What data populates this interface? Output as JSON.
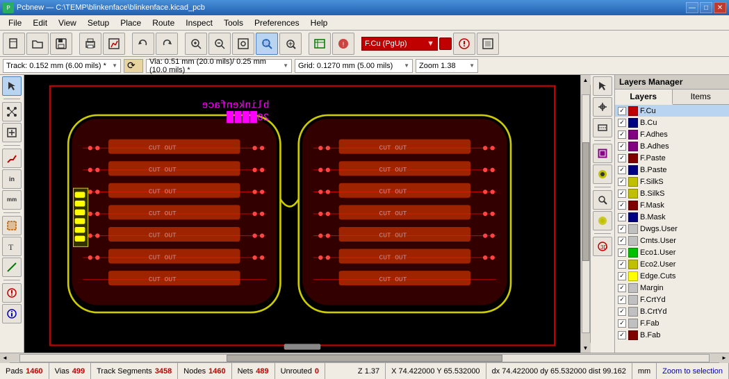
{
  "titlebar": {
    "title": "Pcbnew — C:\\TEMP\\blinkenface\\blinkenface.kicad_pcb",
    "app_icon": "P",
    "minimize": "—",
    "maximize": "□",
    "close": "✕"
  },
  "menu": {
    "items": [
      "File",
      "Edit",
      "View",
      "Setup",
      "Place",
      "Route",
      "Inspect",
      "Tools",
      "Preferences",
      "Help"
    ]
  },
  "toolbar1": {
    "buttons": [
      {
        "icon": "⊞",
        "name": "new-file"
      },
      {
        "icon": "📁",
        "name": "open-file"
      },
      {
        "icon": "💾",
        "name": "save-file"
      },
      {
        "icon": "⊟",
        "name": "save-gerber"
      },
      {
        "icon": "⊞",
        "name": "page-setup"
      },
      {
        "icon": "⊡",
        "name": "print"
      },
      {
        "icon": "📋",
        "name": "plot"
      },
      {
        "icon": "↩",
        "name": "undo"
      },
      {
        "icon": "↪",
        "name": "redo"
      },
      {
        "icon": "🔍",
        "name": "find"
      },
      {
        "icon": "⊕",
        "name": "zoom-in"
      },
      {
        "icon": "⊖",
        "name": "zoom-out"
      },
      {
        "icon": "⊡",
        "name": "zoom-fit"
      },
      {
        "icon": "⊕",
        "name": "zoom-selection"
      },
      {
        "icon": "⊙",
        "name": "zoom-refresh"
      },
      {
        "icon": "≡",
        "name": "net-inspector"
      },
      {
        "icon": "🐛",
        "name": "drc"
      },
      {
        "icon": "F",
        "name": "layer-selector"
      },
      {
        "icon": "⊗",
        "name": "design-rules"
      },
      {
        "icon": "⊞",
        "name": "module-editor"
      }
    ]
  },
  "toolbar2": {
    "track_label": "Track: 0.152 mm (6.00 mils) *",
    "via_label": "Via: 0.51 mm (20.0 mils)/ 0.25 mm (10.0 mils) *",
    "grid_label": "Grid: 0.1270 mm (5.00 mils)",
    "zoom_label": "Zoom 1.38",
    "layer": "F.Cu (PgUp)"
  },
  "left_toolbar": {
    "buttons": [
      {
        "icon": "↖",
        "name": "select-tool"
      },
      {
        "icon": "⊞",
        "name": "local-ratsnest"
      },
      {
        "icon": "⊟",
        "name": "add-module"
      },
      {
        "icon": "⊕",
        "name": "route-track"
      },
      {
        "icon": "in",
        "name": "route-diff-pair"
      },
      {
        "icon": "mm",
        "name": "interactive-router"
      },
      {
        "icon": "⊕",
        "name": "tune-track"
      },
      {
        "icon": "⊙",
        "name": "tune-diff-pair"
      },
      {
        "icon": "⊞",
        "name": "add-text"
      },
      {
        "icon": "⊟",
        "name": "add-graphic-line"
      },
      {
        "icon": "⊗",
        "name": "add-zone"
      },
      {
        "icon": "⊘",
        "name": "drc-button"
      },
      {
        "icon": "⊙",
        "name": "show-ratsnest"
      }
    ]
  },
  "right_toolbar": {
    "buttons": [
      {
        "icon": "↖",
        "name": "cursor-tool"
      },
      {
        "icon": "⊕",
        "name": "add-anchor"
      },
      {
        "icon": "⊠",
        "name": "flip-board"
      },
      {
        "icon": "⊞",
        "name": "module-properties"
      },
      {
        "icon": "⊟",
        "name": "pad-properties"
      },
      {
        "icon": "⊡",
        "name": "zoom-area"
      },
      {
        "icon": "⊗",
        "name": "highlight-net"
      },
      {
        "icon": "⊘",
        "name": "show-board-stats"
      }
    ]
  },
  "layers_panel": {
    "title": "Layers Manager",
    "tabs": [
      "Layers",
      "Items"
    ],
    "active_tab": "Layers",
    "layers": [
      {
        "name": "F.Cu",
        "color": "#c00000",
        "checked": true,
        "selected": true
      },
      {
        "name": "B.Cu",
        "color": "#000080",
        "checked": true
      },
      {
        "name": "F.Adhes",
        "color": "#800080",
        "checked": true
      },
      {
        "name": "B.Adhes",
        "color": "#800080",
        "checked": true
      },
      {
        "name": "F.Paste",
        "color": "#800000",
        "checked": true
      },
      {
        "name": "B.Paste",
        "color": "#000080",
        "checked": true
      },
      {
        "name": "F.SilkS",
        "color": "#c0c000",
        "checked": true
      },
      {
        "name": "B.SilkS",
        "color": "#c0c000",
        "checked": true
      },
      {
        "name": "F.Mask",
        "color": "#800000",
        "checked": true
      },
      {
        "name": "B.Mask",
        "color": "#000080",
        "checked": true
      },
      {
        "name": "Dwgs.User",
        "color": "#c0c0c0",
        "checked": true
      },
      {
        "name": "Cmts.User",
        "color": "#c0c0c0",
        "checked": true
      },
      {
        "name": "Eco1.User",
        "color": "#00c000",
        "checked": true
      },
      {
        "name": "Eco2.User",
        "color": "#c0c000",
        "checked": true
      },
      {
        "name": "Edge.Cuts",
        "color": "#ffff00",
        "checked": true
      },
      {
        "name": "Margin",
        "color": "#c0c0c0",
        "checked": true
      },
      {
        "name": "F.CrtYd",
        "color": "#c0c0c0",
        "checked": true
      },
      {
        "name": "B.CrtYd",
        "color": "#c0c0c0",
        "checked": true
      },
      {
        "name": "F.Fab",
        "color": "#c0c0c0",
        "checked": true
      },
      {
        "name": "B.Fab",
        "color": "#800000",
        "checked": true
      }
    ]
  },
  "statusbar": {
    "pads_label": "Pads",
    "pads_val": "1460",
    "vias_label": "Vias",
    "vias_val": "499",
    "track_label": "Track Segments",
    "track_val": "3458",
    "nodes_label": "Nodes",
    "nodes_val": "1460",
    "nets_label": "Nets",
    "nets_val": "489",
    "unrouted_label": "Unrouted",
    "unrouted_val": "0",
    "coord": "Z 1.37",
    "xy": "X 74.422000  Y 65.532000",
    "dx_dy": "dx 74.422000  dy 65.532000  dist 99.162",
    "units": "mm",
    "zoom_to_sel": "Zoom to selection"
  }
}
